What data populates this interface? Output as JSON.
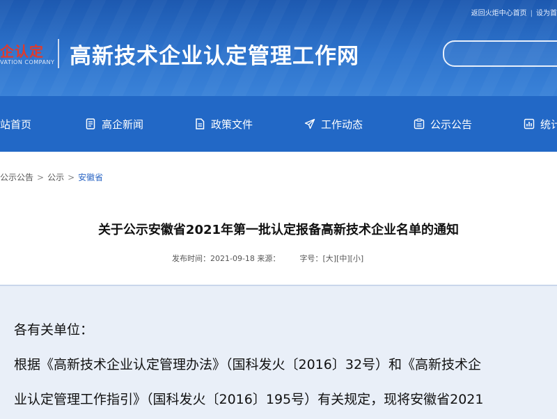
{
  "header": {
    "top_links": [
      "返回火炬中心首页",
      "设为首"
    ],
    "logo_cn": "企认定",
    "logo_en": "VATION COMPANY",
    "site_title": "高新技术企业认定管理工作网",
    "colors": {
      "header_bg": "#2d73cc",
      "nav_bg": "#2268c6",
      "logo_red": "#e23a2a"
    }
  },
  "nav": {
    "items": [
      {
        "label": "站首页",
        "icon": "home-icon"
      },
      {
        "label": "高企新闻",
        "icon": "news-document-icon"
      },
      {
        "label": "政策文件",
        "icon": "policy-file-icon"
      },
      {
        "label": "工作动态",
        "icon": "paper-plane-icon"
      },
      {
        "label": "公示公告",
        "icon": "announcement-list-icon"
      },
      {
        "label": "统计",
        "icon": "statistics-icon"
      }
    ]
  },
  "breadcrumb": {
    "items": [
      "公示公告",
      "公示",
      "安徽省"
    ],
    "separator": ">"
  },
  "article": {
    "title": "关于公示安徽省2021年第一批认定报备高新技术企业名单的通知",
    "publish_label": "发布时间：2021-09-18 来源：",
    "font_size_label": "字号：",
    "font_sizes": [
      "[大]",
      "[中]",
      "[小]"
    ],
    "paragraphs": [
      "各有关单位：",
      "根据《高新技术企业认定管理办法》（国科发火〔2016〕32号）和《高新技术企",
      "业认定管理工作指引》（国科发火〔2016〕195号）有关规定，现将安徽省2021"
    ]
  }
}
